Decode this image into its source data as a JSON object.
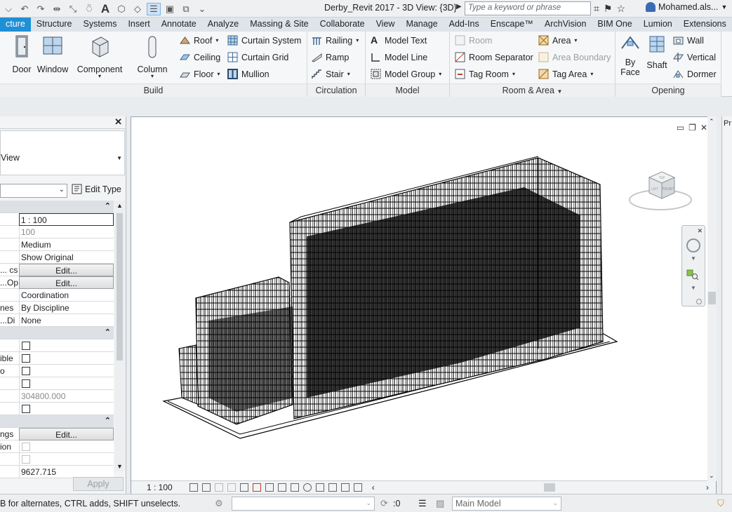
{
  "titlebar": {
    "document_title": "Derby_Revit 2017 - 3D View: {3D}",
    "search_placeholder": "Type a keyword or phrase",
    "user_name": "Mohamed.als..."
  },
  "tabs": [
    "cture",
    "Structure",
    "Systems",
    "Insert",
    "Annotate",
    "Analyze",
    "Massing & Site",
    "Collaborate",
    "View",
    "Manage",
    "Add-Ins",
    "Enscape™",
    "ArchVision",
    "BIM One",
    "Lumion",
    "Extensions"
  ],
  "active_tab": "cture",
  "ribbon": {
    "build": {
      "title": "Build",
      "door": "Door",
      "window": "Window",
      "component": "Component",
      "column": "Column",
      "roof": "Roof",
      "ceiling": "Ceiling",
      "floor": "Floor",
      "curtain_system": "Curtain System",
      "curtain_grid": "Curtain Grid",
      "mullion": "Mullion"
    },
    "circulation": {
      "title": "Circulation",
      "railing": "Railing",
      "ramp": "Ramp",
      "stair": "Stair"
    },
    "model": {
      "title": "Model",
      "model_text": "Model Text",
      "model_line": "Model Line",
      "model_group": "Model Group"
    },
    "room_area": {
      "title": "Room & Area",
      "room": "Room",
      "room_separator": "Room Separator",
      "tag_room": "Tag Room",
      "area": "Area",
      "area_boundary": "Area Boundary",
      "tag_area": "Tag Area"
    },
    "opening": {
      "title": "Opening",
      "by_face_1": "By",
      "by_face_2": "Face",
      "shaft": "Shaft",
      "wall": "Wall",
      "vertical": "Vertical",
      "dormer": "Dormer"
    }
  },
  "properties": {
    "type_label": "View",
    "edit_type": "Edit Type",
    "rows": [
      {
        "label": "",
        "value": "1 : 100",
        "kind": "box"
      },
      {
        "label": "",
        "value": "100",
        "kind": "gray"
      },
      {
        "label": "",
        "value": "Medium",
        "kind": "text"
      },
      {
        "label": "",
        "value": "Show Original",
        "kind": "text"
      },
      {
        "label": "cs ...",
        "value": "Edit...",
        "kind": "btn"
      },
      {
        "label": "Op...",
        "value": "Edit...",
        "kind": "btn"
      },
      {
        "label": "",
        "value": "Coordination",
        "kind": "text"
      },
      {
        "label": "nes",
        "value": "By Discipline",
        "kind": "text"
      },
      {
        "label": "Di...",
        "value": "None",
        "kind": "text"
      },
      {
        "label": "",
        "value": "",
        "kind": "section"
      },
      {
        "label": "",
        "value": "",
        "kind": "check"
      },
      {
        "label": "ible",
        "value": "",
        "kind": "check"
      },
      {
        "label": "o",
        "value": "",
        "kind": "check"
      },
      {
        "label": "",
        "value": "",
        "kind": "check"
      },
      {
        "label": "",
        "value": "304800.000",
        "kind": "gray"
      },
      {
        "label": "",
        "value": "",
        "kind": "check"
      },
      {
        "label": "",
        "value": "",
        "kind": "section"
      },
      {
        "label": "ngs",
        "value": "Edit...",
        "kind": "btn"
      },
      {
        "label": "ion",
        "value": "",
        "kind": "checkdis"
      },
      {
        "label": "",
        "value": "",
        "kind": "checkdis"
      },
      {
        "label": "",
        "value": "9627.715",
        "kind": "text"
      }
    ],
    "apply": "Apply"
  },
  "view": {
    "scale": "1 : 100"
  },
  "viewcube": {
    "top": "TOP",
    "front": "FRONT",
    "left": "LEFT"
  },
  "rightpanel": {
    "label": "Pr"
  },
  "status": {
    "message": "B for alternates, CTRL adds, SHIFT unselects.",
    "zero": ":0",
    "model": "Main Model"
  }
}
